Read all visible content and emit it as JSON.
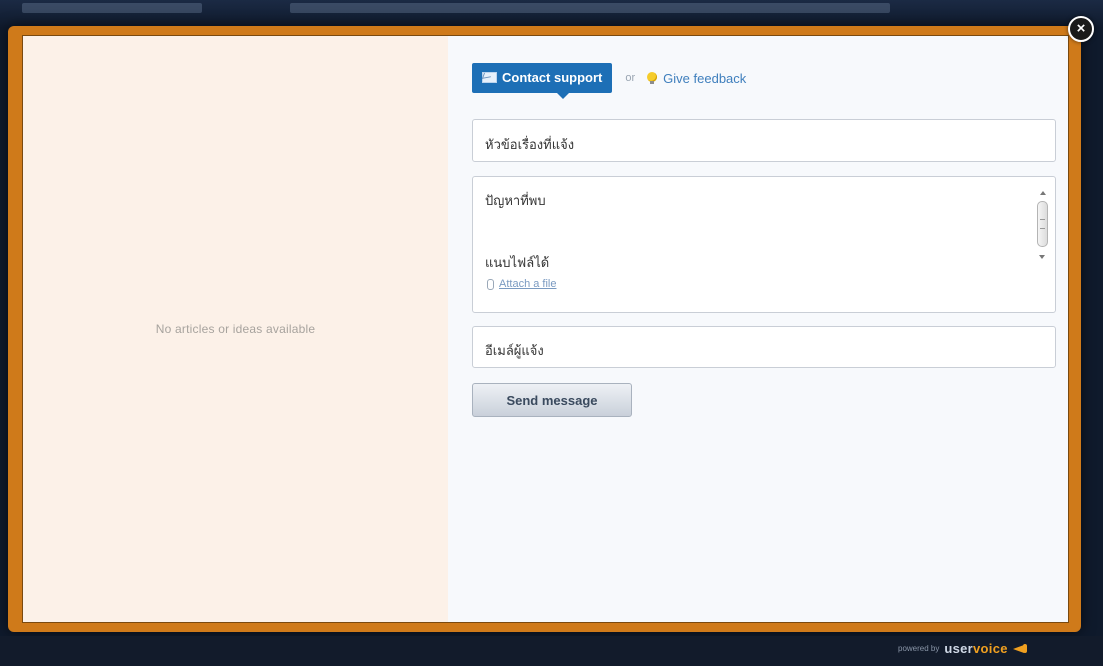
{
  "left_panel": {
    "empty_text": "No articles or ideas available"
  },
  "tabs": {
    "active_label": "Contact support",
    "separator": "or",
    "inactive_label": "Give feedback"
  },
  "form": {
    "subject_value": "หัวข้อเรื่องที่แจ้ง",
    "message_value": "ปัญหาที่พบ",
    "attach_label": "แนบไฟล์ได้",
    "attach_link": "Attach a file",
    "email_value": "อีเมล์ผู้แจ้ง",
    "send_label": "Send message"
  },
  "close_label": "×",
  "footer": {
    "powered_by": "powered by",
    "brand_user": "user",
    "brand_voice": "voice"
  },
  "icons": {
    "active_tab": "mail-icon",
    "inactive_tab": "lightbulb-icon",
    "attach": "paperclip-icon",
    "close": "close-icon",
    "brand": "megaphone-icon"
  },
  "colors": {
    "modal_border": "#cf7a1a",
    "active_tab": "#1d6fb6",
    "link": "#3f7fbd",
    "left_pane_bg": "#fcf1e8"
  }
}
